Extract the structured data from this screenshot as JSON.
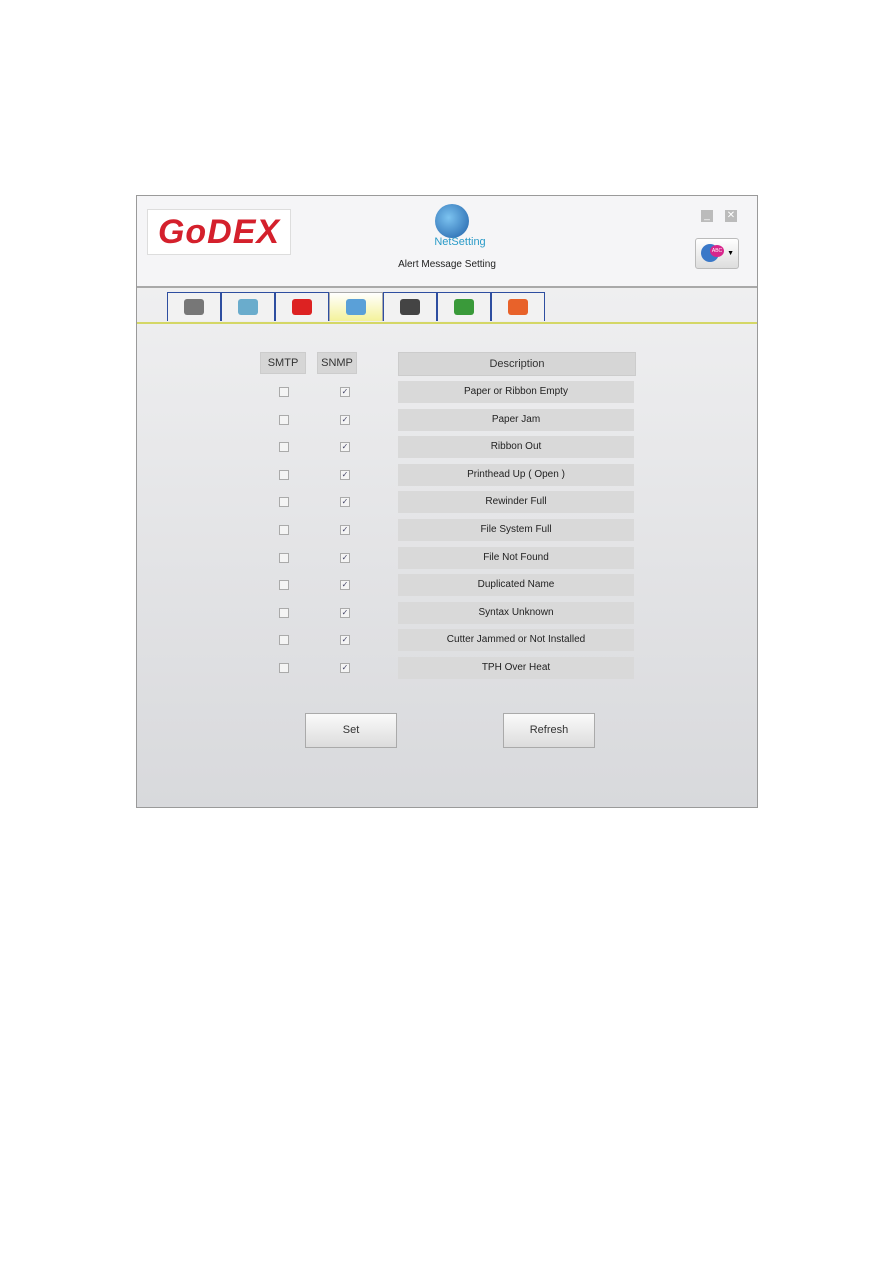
{
  "header": {
    "logo": "GoDEX",
    "app_name": "NetSetting",
    "title": "Alert Message Setting"
  },
  "tabs": [
    {
      "icon": "printer-icon"
    },
    {
      "icon": "network-icon"
    },
    {
      "icon": "alarm-icon"
    },
    {
      "icon": "alert-mail-icon",
      "active": true
    },
    {
      "icon": "gears-icon"
    },
    {
      "icon": "key-file-icon"
    },
    {
      "icon": "refresh-icon"
    }
  ],
  "columns": {
    "smtp": "SMTP",
    "snmp": "SNMP",
    "description": "Description"
  },
  "rows": [
    {
      "description": "Paper or Ribbon Empty",
      "smtp": false,
      "snmp": true
    },
    {
      "description": "Paper Jam",
      "smtp": false,
      "snmp": true
    },
    {
      "description": "Ribbon Out",
      "smtp": false,
      "snmp": true
    },
    {
      "description": "Printhead Up ( Open )",
      "smtp": false,
      "snmp": true
    },
    {
      "description": "Rewinder Full",
      "smtp": false,
      "snmp": true
    },
    {
      "description": "File System Full",
      "smtp": false,
      "snmp": true
    },
    {
      "description": "File Not Found",
      "smtp": false,
      "snmp": true
    },
    {
      "description": "Duplicated Name",
      "smtp": false,
      "snmp": true
    },
    {
      "description": "Syntax Unknown",
      "smtp": false,
      "snmp": true
    },
    {
      "description": "Cutter Jammed or Not Installed",
      "smtp": false,
      "snmp": true
    },
    {
      "description": "TPH Over Heat",
      "smtp": false,
      "snmp": true
    }
  ],
  "buttons": {
    "set": "Set",
    "refresh": "Refresh"
  },
  "colors": {
    "logo": "#d4202c",
    "active_tab": "#f4f29a",
    "tab_border": "#2e4ea0"
  }
}
